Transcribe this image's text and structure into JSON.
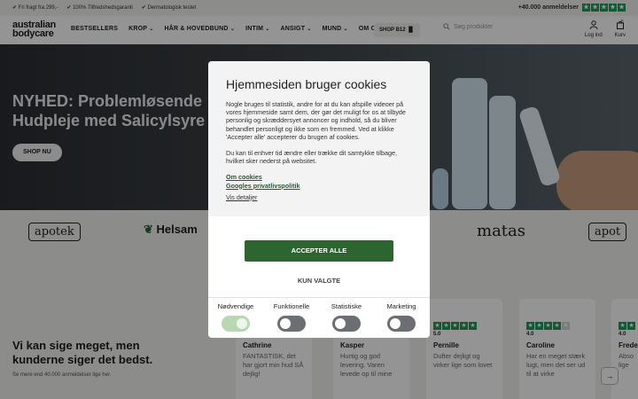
{
  "topbar": {
    "perks": [
      "✔ Fri fragt fra 299,-",
      "✔ 100% Tilfredshedsgaranti",
      "✔ Dermatologisk testet"
    ],
    "rating_text": "+40.000 anmeldelser"
  },
  "header": {
    "logo_line1": "australian",
    "logo_line2": "bodycare",
    "nav": [
      {
        "label": "BESTSELLERS",
        "chev": ""
      },
      {
        "label": "KROP",
        "chev": "⌄"
      },
      {
        "label": "HÅR & HOVEDBUND",
        "chev": "⌄"
      },
      {
        "label": "INTIM",
        "chev": "⌄"
      },
      {
        "label": "ANSIGT",
        "chev": "⌄"
      },
      {
        "label": "MUND",
        "chev": "⌄"
      },
      {
        "label": "OM OS",
        "chev": "⌄"
      }
    ],
    "shop_label": "SHOP B12 ▐▌",
    "search_placeholder": "Søg produkter",
    "login_label": "Log ind",
    "cart_label": "Kurv",
    "cart_count": "0"
  },
  "hero": {
    "title_line1": "NYHED: Problemløsende",
    "title_line2": "Hudpleje med Salicylsyre",
    "button": "SHOP NU"
  },
  "logos": [
    "apotek",
    "Helsam",
    "matas",
    "apot"
  ],
  "reviews": {
    "heading": "Vi kan sige meget, men kunderne siger det bedst.",
    "sub": "Se mere end 40.000 anmeldelser lige her.",
    "cards": [
      {
        "score": "",
        "name": "Cathrine",
        "text": "FANTASTISK, det har gjort min hud SÅ dejlig!",
        "stars": 5
      },
      {
        "score": "",
        "name": "Kasper",
        "text": "Hurtig og god levering. Varen levede op til mine",
        "stars": 5
      },
      {
        "score": "5.0",
        "name": "Pernille",
        "text": "Dufter dejligt og virker lige som lovet",
        "stars": 5
      },
      {
        "score": "4.0",
        "name": "Caroline",
        "text": "Har en meget stærk lugt, men det ser ud til at virke",
        "stars": 4
      },
      {
        "score": "4.0",
        "name": "Frede",
        "text": "Abso lige",
        "stars": 4
      }
    ]
  },
  "cookie": {
    "title": "Hjemmesiden bruger cookies",
    "p1": "Nogle bruges til statistik, andre for at du kan afspille videoer på vores hjemmeside samt dem, der gør det muligt for os at tilbyde personlig og skræddersyet annoncer og indhold, så du bliver behandlet personligt og ikke som en fremmed. Ved at klikke 'Accepter alle' accepterer du brugen af cookies.",
    "p2": "Du kan til enhver tid ændre eller trække dit samtykke tilbage, hvilket sker nederst på websitet.",
    "link_about": "Om cookies",
    "link_google": "Googles privatlivspolitik",
    "link_details": "Vis detaljer",
    "accept_all": "ACCEPTER ALLE",
    "only_selected": "KUN VALGTE",
    "toggles": [
      {
        "label": "Nødvendige",
        "on": true
      },
      {
        "label": "Funktionelle",
        "on": false
      },
      {
        "label": "Statistiske",
        "on": false
      },
      {
        "label": "Marketing",
        "on": false
      }
    ]
  },
  "colors": {
    "accent": "#2c6530",
    "trustpilot": "#1c9a5a",
    "overlay": "rgba(0,0,0,0.42)"
  }
}
